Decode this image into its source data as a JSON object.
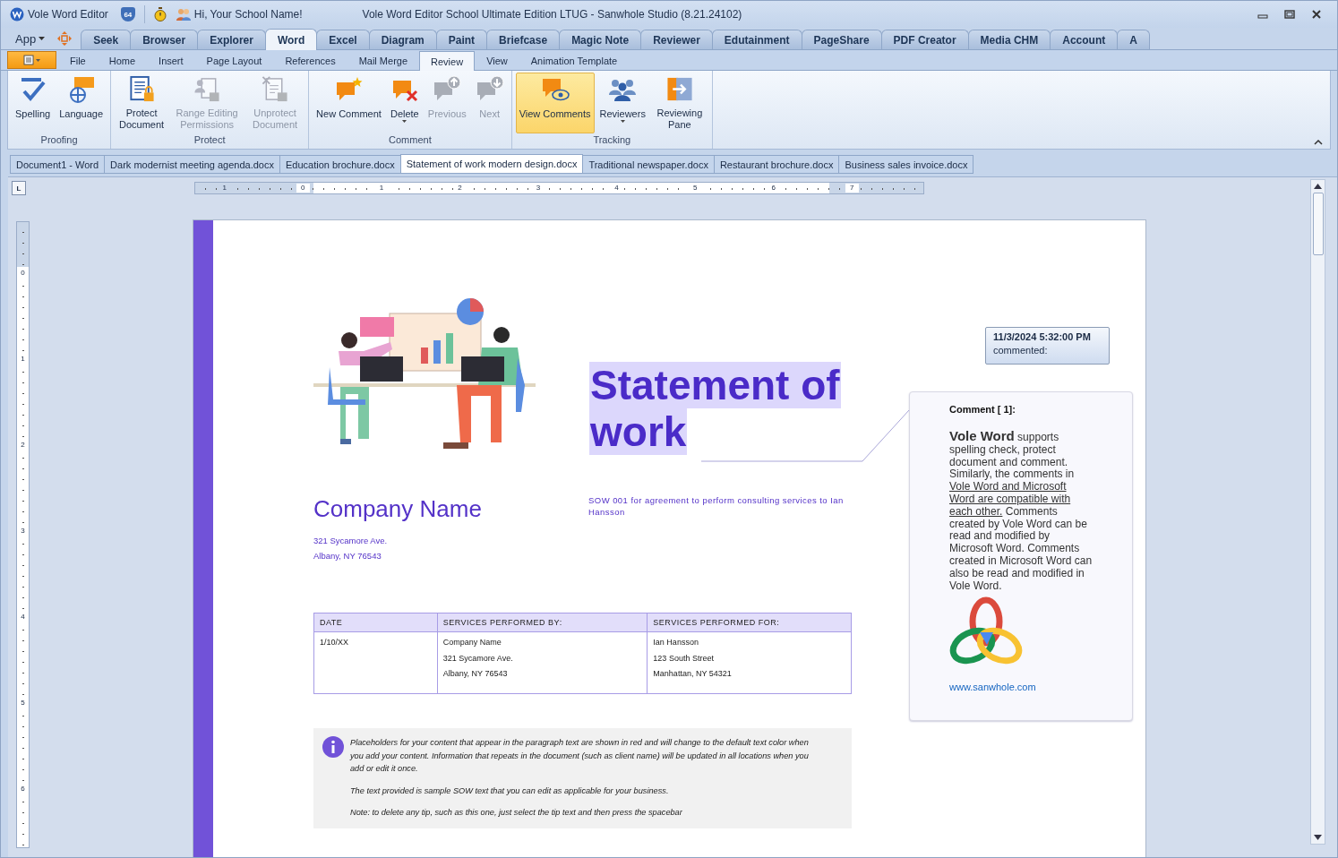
{
  "window": {
    "app_name": "Vole Word Editor",
    "badge": "64",
    "greeting": "Hi, Your School Name!",
    "title": "Vole Word Editor School Ultimate Edition LTUG - Sanwhole Studio (8.21.24102)"
  },
  "app_menu": {
    "label": "App"
  },
  "app_tabs": [
    {
      "label": "Seek",
      "selected": false
    },
    {
      "label": "Browser",
      "selected": false
    },
    {
      "label": "Explorer",
      "selected": false
    },
    {
      "label": "Word",
      "selected": true
    },
    {
      "label": "Excel",
      "selected": false
    },
    {
      "label": "Diagram",
      "selected": false
    },
    {
      "label": "Paint",
      "selected": false
    },
    {
      "label": "Briefcase",
      "selected": false
    },
    {
      "label": "Magic Note",
      "selected": false
    },
    {
      "label": "Reviewer",
      "selected": false
    },
    {
      "label": "Edutainment",
      "selected": false
    },
    {
      "label": "PageShare",
      "selected": false
    },
    {
      "label": "PDF Creator",
      "selected": false
    },
    {
      "label": "Media CHM",
      "selected": false
    },
    {
      "label": "Account",
      "selected": false
    },
    {
      "label": "A",
      "selected": false
    }
  ],
  "ribbon_tabs": [
    {
      "label": "File",
      "selected": false
    },
    {
      "label": "Home",
      "selected": false
    },
    {
      "label": "Insert",
      "selected": false
    },
    {
      "label": "Page Layout",
      "selected": false
    },
    {
      "label": "References",
      "selected": false
    },
    {
      "label": "Mail Merge",
      "selected": false
    },
    {
      "label": "Review",
      "selected": true
    },
    {
      "label": "View",
      "selected": false
    },
    {
      "label": "Animation Template",
      "selected": false
    }
  ],
  "ribbon": {
    "groups": [
      {
        "label": "Proofing",
        "buttons": [
          {
            "label": "Spelling",
            "disabled": false,
            "selected": false,
            "dropdown": false
          },
          {
            "label": "Language",
            "disabled": false,
            "selected": false,
            "dropdown": false
          }
        ]
      },
      {
        "label": "Protect",
        "buttons": [
          {
            "label": "Protect Document",
            "disabled": false,
            "selected": false,
            "dropdown": false
          },
          {
            "label": "Range Editing Permissions",
            "disabled": true,
            "selected": false,
            "dropdown": false
          },
          {
            "label": "Unprotect Document",
            "disabled": true,
            "selected": false,
            "dropdown": false
          }
        ]
      },
      {
        "label": "Comment",
        "buttons": [
          {
            "label": "New Comment",
            "disabled": false,
            "selected": false,
            "dropdown": false
          },
          {
            "label": "Delete",
            "disabled": false,
            "selected": false,
            "dropdown": true
          },
          {
            "label": "Previous",
            "disabled": true,
            "selected": false,
            "dropdown": false
          },
          {
            "label": "Next",
            "disabled": true,
            "selected": false,
            "dropdown": false
          }
        ]
      },
      {
        "label": "Tracking",
        "buttons": [
          {
            "label": "View Comments",
            "disabled": false,
            "selected": true,
            "dropdown": false
          },
          {
            "label": "Reviewers",
            "disabled": false,
            "selected": false,
            "dropdown": true
          },
          {
            "label": "Reviewing Pane",
            "disabled": false,
            "selected": false,
            "dropdown": false
          }
        ]
      }
    ]
  },
  "document_tabs": [
    {
      "label": "Document1 - Word",
      "selected": false
    },
    {
      "label": "Dark modernist meeting agenda.docx",
      "selected": false
    },
    {
      "label": "Education brochure.docx",
      "selected": false
    },
    {
      "label": "Statement of work modern design.docx",
      "selected": true
    },
    {
      "label": "Traditional newspaper.docx",
      "selected": false
    },
    {
      "label": "Restaurant brochure.docx",
      "selected": false
    },
    {
      "label": "Business sales invoice.docx",
      "selected": false
    }
  ],
  "ruler": {
    "corner": "L",
    "horizontal_labels": [
      "1",
      "0",
      "1",
      "2",
      "3",
      "4",
      "5",
      "6",
      "7"
    ],
    "vertical_labels": [
      "0",
      "1",
      "2",
      "3",
      "4",
      "5",
      "6"
    ]
  },
  "document": {
    "title_lines": [
      "Statement of",
      "work"
    ],
    "company": "Company Name",
    "address": [
      "321 Sycamore Ave.",
      "Albany, NY 76543"
    ],
    "sow": "SOW 001 for agreement to perform consulting services to Ian Hansson",
    "table": {
      "columns": [
        "DATE",
        "SERVICES PERFORMED BY:",
        "SERVICES PERFORMED FOR:"
      ],
      "rows": [
        [
          [
            "1/10/XX"
          ],
          [
            "Company Name",
            "321 Sycamore Ave.",
            "Albany, NY 76543"
          ],
          [
            "Ian Hansson",
            "123 South Street",
            "Manhattan, NY 54321"
          ]
        ]
      ]
    },
    "tip": {
      "paragraphs": [
        "Placeholders for your content that appear in the paragraph text are shown in red and will change to the default text color when you add your content. Information that repeats in the document (such as client name) will be updated in all locations when you add or edit it once.",
        "The text provided is sample SOW text that you can edit as applicable for your business.",
        "Note: to delete any tip, such as this one, just select the tip text and then press the spacebar"
      ]
    }
  },
  "comment": {
    "date": "11/3/2024 5:32:00 PM",
    "action": "commented:",
    "heading": "Comment [ 1]:",
    "body": [
      {
        "text": "**Vole Word** supports spelling check, protect document and comment. Similarly, the comments in ",
        "underlined": false
      },
      {
        "text": "Vole Word and Microsoft Word are compatible with each other.",
        "underlined": true
      },
      {
        "text": " Comments created by Vole Word can be read and modified by Microsoft Word. Comments created in Microsoft Word can also be read and modified in Vole Word.",
        "underlined": false
      }
    ],
    "link": "www.sanwhole.com"
  }
}
